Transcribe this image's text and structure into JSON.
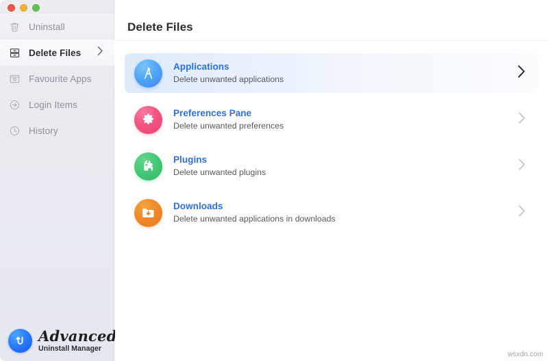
{
  "window": {
    "traffic_lights": [
      {
        "name": "close",
        "color": "#e9564a"
      },
      {
        "name": "minimize",
        "color": "#f0b138"
      },
      {
        "name": "zoom",
        "color": "#5ec353"
      }
    ]
  },
  "sidebar": {
    "items": [
      {
        "label": "Uninstall",
        "icon": "trash-icon",
        "selected": false
      },
      {
        "label": "Delete Files",
        "icon": "file-drawer-icon",
        "selected": true
      },
      {
        "label": "Favourite Apps",
        "icon": "heart-window-icon",
        "selected": false
      },
      {
        "label": "Login Items",
        "icon": "arrow-in-circle-icon",
        "selected": false
      },
      {
        "label": "History",
        "icon": "clock-icon",
        "selected": false
      }
    ],
    "logo": {
      "mark_icon": "circular-arrow-logo-icon",
      "word": "Advanced",
      "subtitle": "Uninstall Manager"
    }
  },
  "main": {
    "title": "Delete Files",
    "rows": [
      {
        "title": "Applications",
        "subtitle": "Delete unwanted applications",
        "icon": "compass-icon",
        "icon_color": "#3d86f0",
        "active": true
      },
      {
        "title": "Preferences Pane",
        "subtitle": "Delete unwanted preferences",
        "icon": "gear-icon",
        "icon_color": "#ea3f6e",
        "active": false
      },
      {
        "title": "Plugins",
        "subtitle": "Delete unwanted plugins",
        "icon": "puzzle-piece-icon",
        "icon_color": "#33b867",
        "active": false
      },
      {
        "title": "Downloads",
        "subtitle": "Delete unwanted applications in downloads",
        "icon": "folder-download-icon",
        "icon_color": "#e97820",
        "active": false
      }
    ]
  },
  "watermark": "wsxdn.com",
  "colors": {
    "accent_blue": "#2d6fe0",
    "sidebar_bg": "#e9eaf1",
    "active_row_bg": "#dfeaf9"
  }
}
